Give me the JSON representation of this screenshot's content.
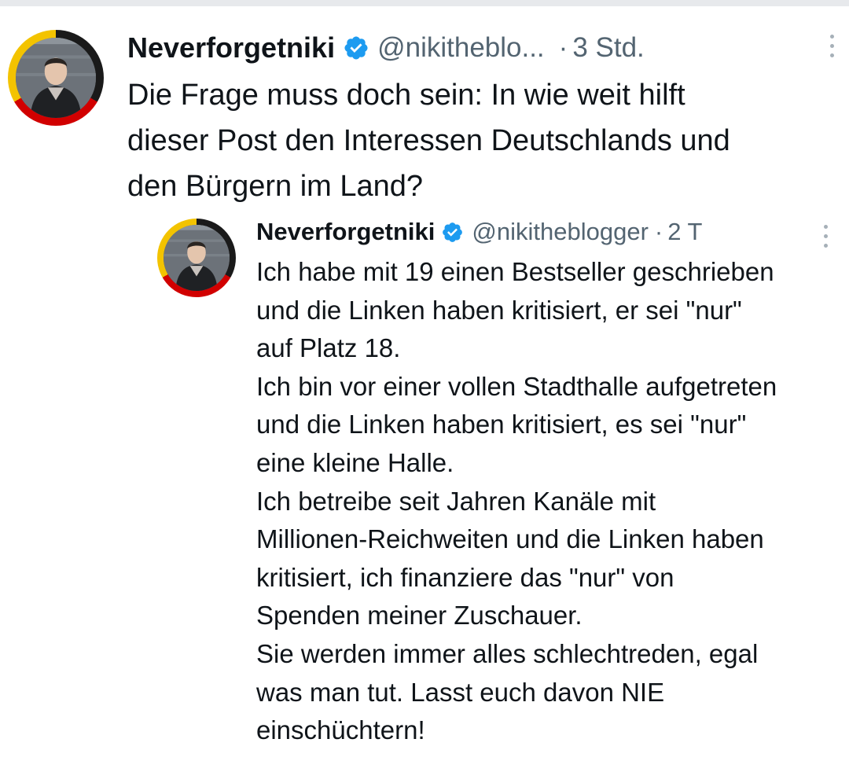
{
  "tweet": {
    "display_name": "Neverforgetniki",
    "handle": "@nikitheblo...",
    "dot": "·",
    "time": "3 Std.",
    "text": "Die Frage muss doch sein: In wie weit hilft\ndieser Post den Interessen Deutschlands und\nden Bürgern im Land?",
    "avatar_icon": "profile-photo-german-flag-ring",
    "verified_icon": "verified-badge-icon",
    "more_icon": "more-options-icon"
  },
  "quoted": {
    "display_name": "Neverforgetniki",
    "handle": "@nikitheblogger",
    "dot": "·",
    "time": "2 T",
    "lines": [
      "Ich habe mit 19 einen Bestseller geschrieben",
      "und die Linken haben kritisiert, er sei \"nur\"",
      "auf Platz 18.",
      "Ich bin vor einer vollen Stadthalle aufgetreten",
      "und die Linken haben kritisiert, es sei \"nur\"",
      "eine kleine Halle.",
      "Ich betreibe seit Jahren Kanäle mit",
      "Millionen-Reichweiten und die Linken haben",
      "kritisiert, ich finanziere das \"nur\" von",
      "Spenden meiner Zuschauer.",
      "Sie werden immer alles schlechtreden, egal",
      "was man tut. Lasst euch davon NIE",
      "einschüchtern!"
    ]
  },
  "colors": {
    "text_primary": "#0f1419",
    "text_secondary": "#536471",
    "verified_blue": "#1d9bf0",
    "divider": "#e7e9ec",
    "flag_black": "#1a1a1a",
    "flag_red": "#d10000",
    "flag_gold": "#f3c300"
  }
}
